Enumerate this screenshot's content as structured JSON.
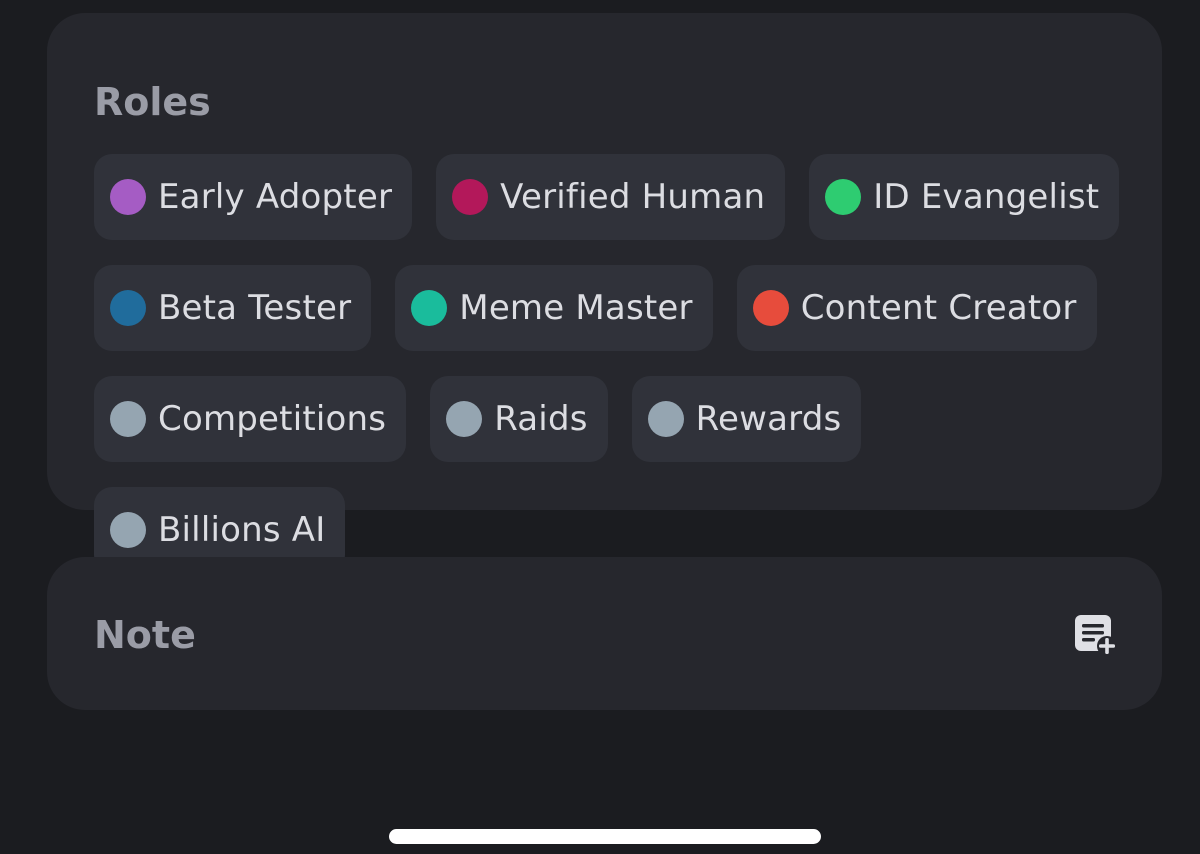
{
  "roles": {
    "title": "Roles",
    "items": [
      {
        "label": "Early Adopter",
        "color": "#a55cc4"
      },
      {
        "label": "Verified Human",
        "color": "#b3185a"
      },
      {
        "label": "ID Evangelist",
        "color": "#2ecc71"
      },
      {
        "label": "Beta Tester",
        "color": "#206c9c"
      },
      {
        "label": "Meme Master",
        "color": "#1abc9c"
      },
      {
        "label": "Content Creator",
        "color": "#e74c3c"
      },
      {
        "label": "Competitions",
        "color": "#95a5b1"
      },
      {
        "label": "Raids",
        "color": "#95a5b1"
      },
      {
        "label": "Rewards",
        "color": "#95a5b1"
      },
      {
        "label": "Billions AI",
        "color": "#95a5b1"
      }
    ]
  },
  "note": {
    "title": "Note",
    "add_icon": "note-add-icon"
  }
}
